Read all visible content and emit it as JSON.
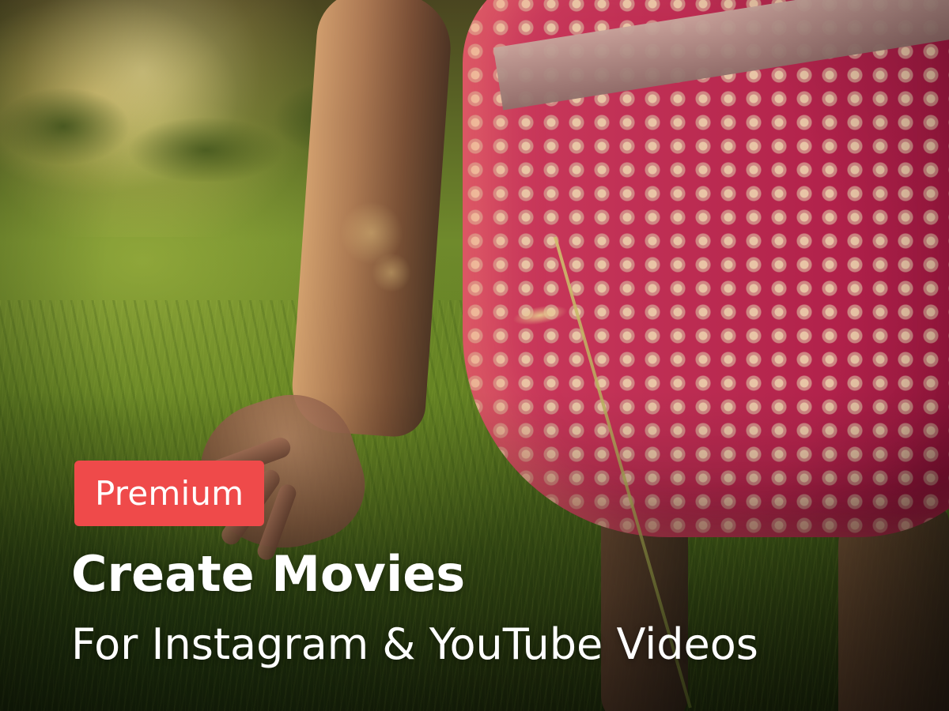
{
  "badge": {
    "label": "Premium",
    "color": "#ef4a4a"
  },
  "headline": {
    "title": "Create Movies",
    "subtitle": "For Instagram & YouTube Videos"
  },
  "colors": {
    "text": "#ffffff",
    "dress": "#b21c4a",
    "grass": "#5f7d22"
  }
}
